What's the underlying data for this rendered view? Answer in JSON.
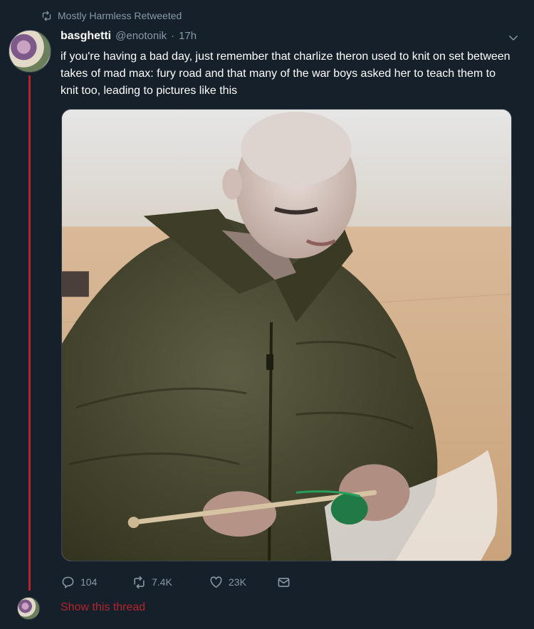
{
  "retweet": {
    "icon": "retweet-icon",
    "label": "Mostly Harmless Retweeted"
  },
  "tweet": {
    "display_name": "basghetti",
    "handle": "@enotonik",
    "separator": "·",
    "time": "17h",
    "text": "if you're having a bad day, just remember that charlize theron used to knit on set between takes of mad max: fury road and that many of the war boys asked her to teach them to knit too, leading to pictures like this",
    "avatar_icon": "avatar",
    "menu_icon": "chevron-down-icon",
    "media_icon": "photo"
  },
  "actions": {
    "reply_icon": "reply-icon",
    "reply_count": "104",
    "retweet_icon": "retweet-icon",
    "retweet_count": "7.4K",
    "like_icon": "heart-icon",
    "like_count": "23K",
    "dm_icon": "mail-icon"
  },
  "thread": {
    "show_label": "Show this thread"
  },
  "colors": {
    "background": "#15202b",
    "text": "#ffffff",
    "muted": "#8899a6",
    "thread_accent": "#b3252a"
  }
}
